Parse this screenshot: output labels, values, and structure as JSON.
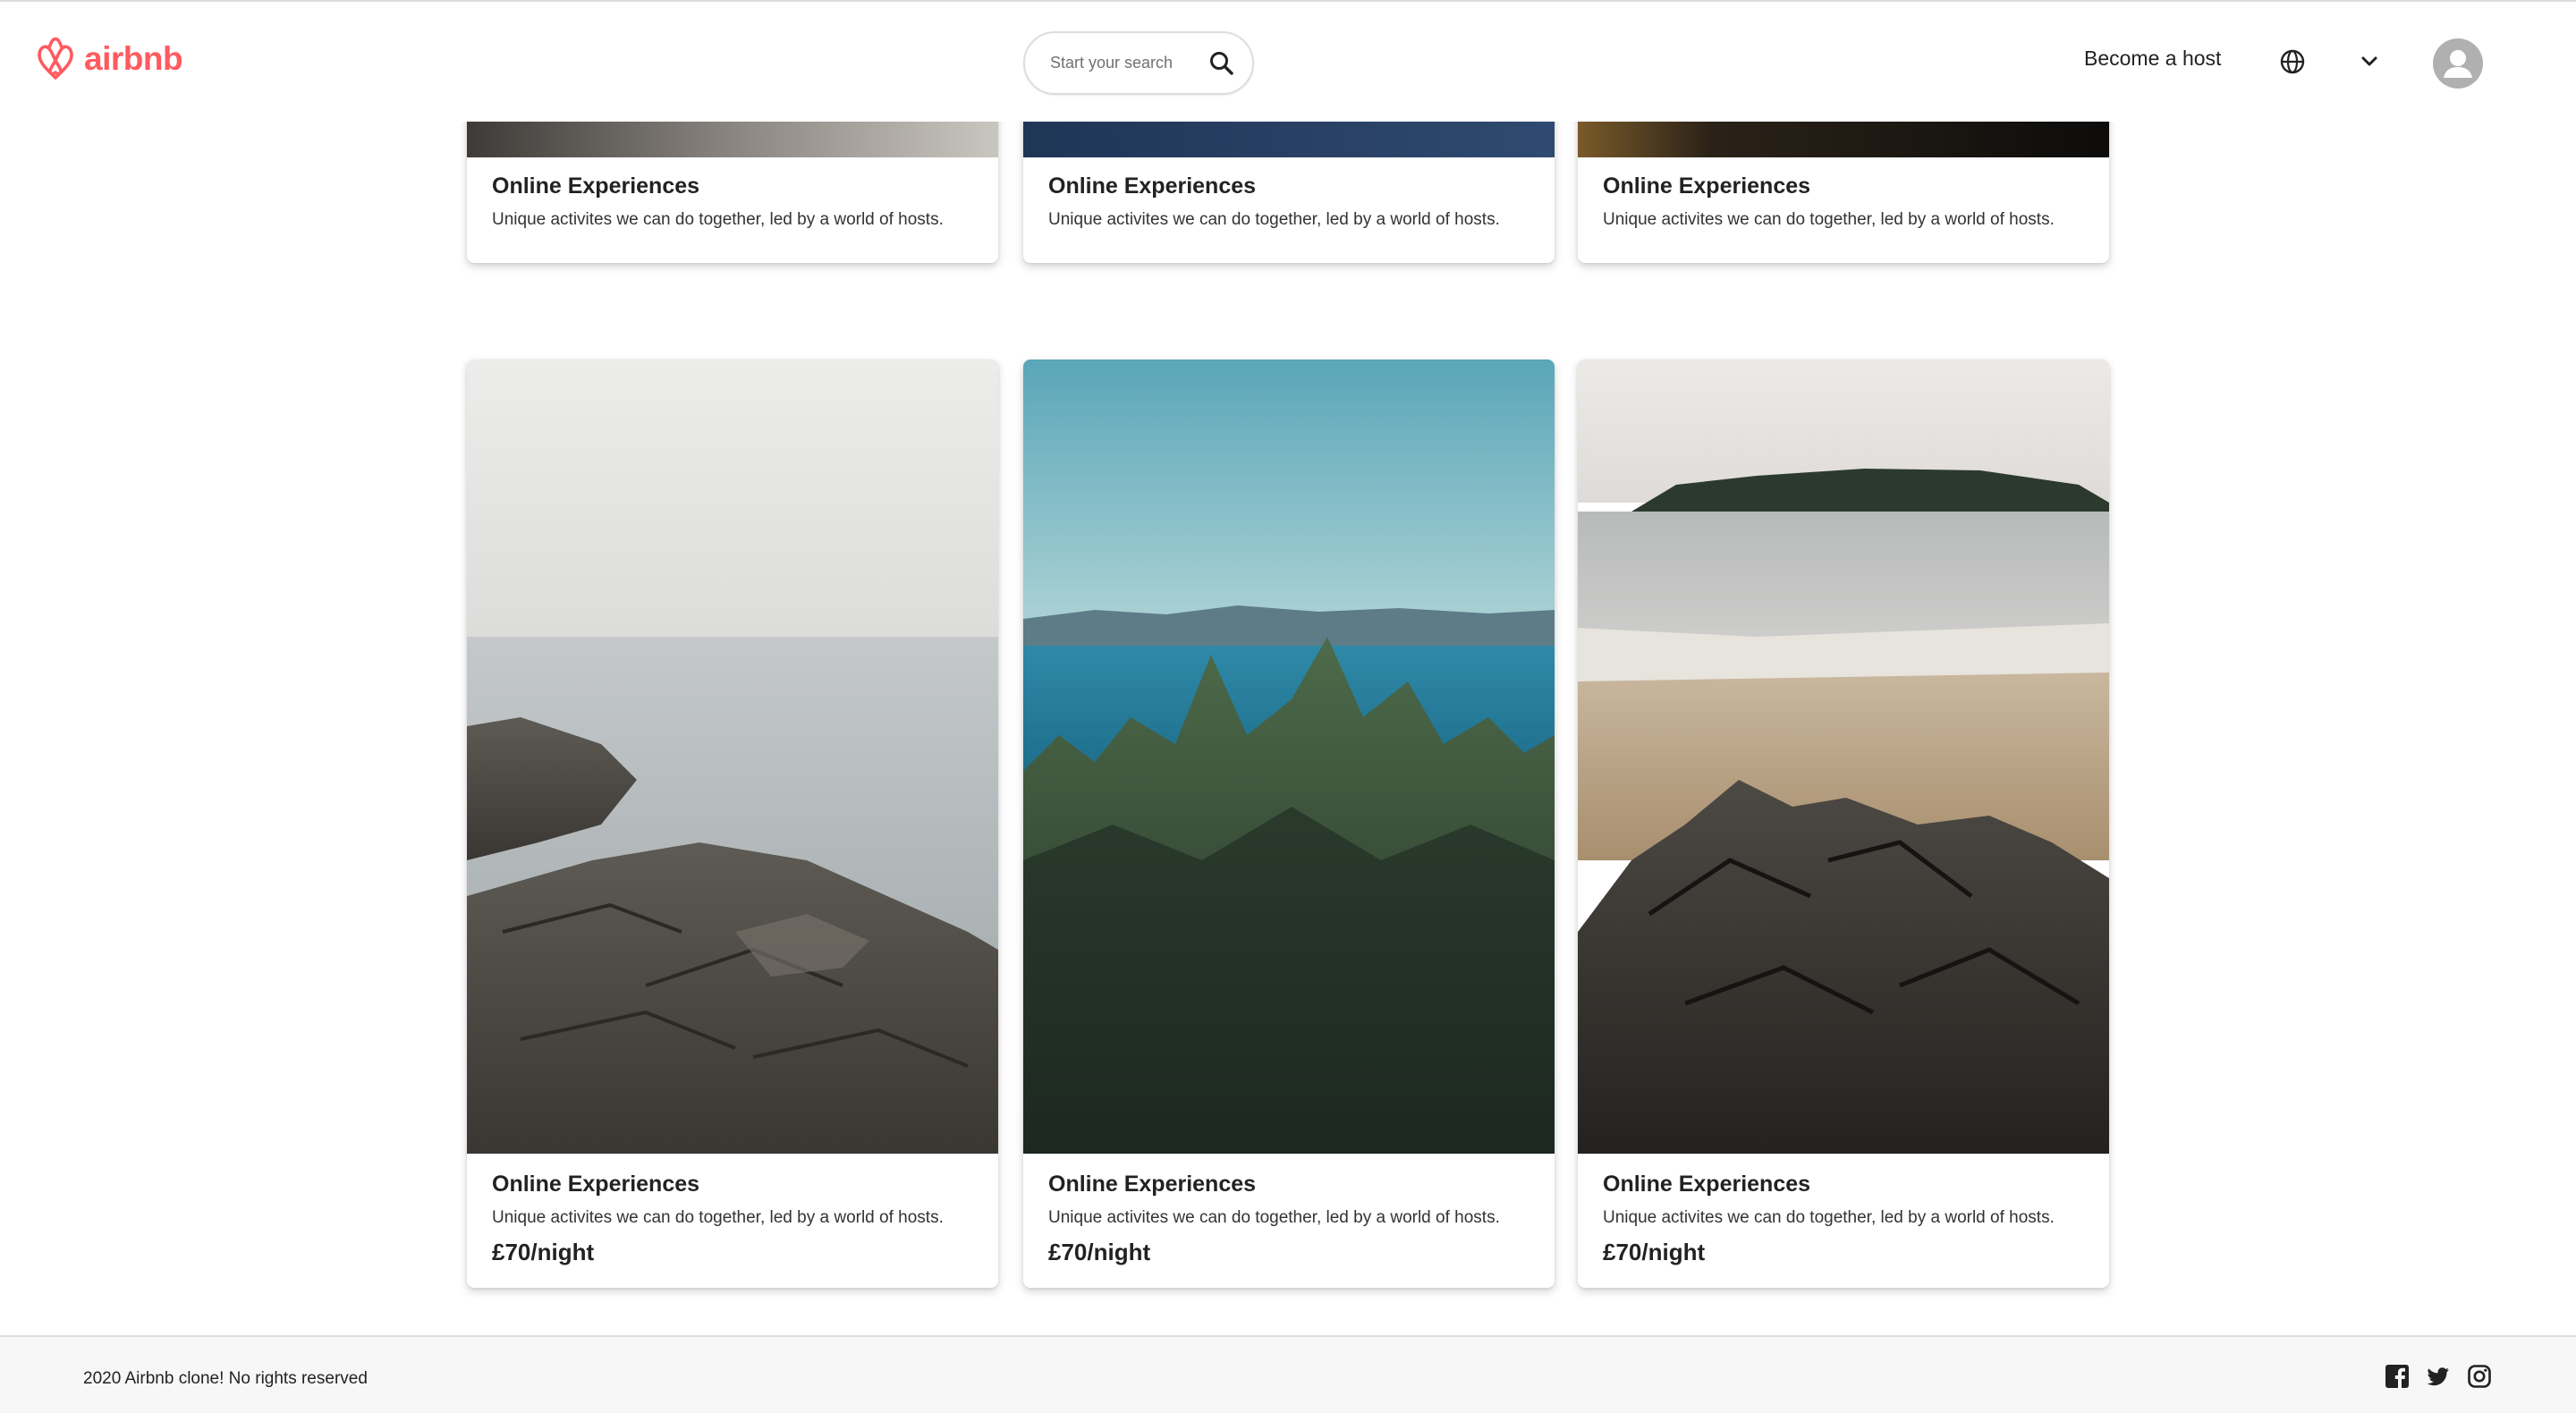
{
  "header": {
    "logo_text": "airbnb",
    "search_placeholder": "Start your search",
    "become_host_label": "Become a host",
    "icons": [
      "airbnb-logo-icon",
      "search-icon",
      "globe-icon",
      "chevron-down-icon",
      "user-avatar-icon"
    ]
  },
  "colors": {
    "brand": "#FF5A5F",
    "text": "#222222",
    "footer_bg": "#F7F7F7",
    "border": "#DDDDDD"
  },
  "top_cards": [
    {
      "title": "Online Experiences",
      "description": "Unique activites we can do together, led by a world of hosts."
    },
    {
      "title": "Online Experiences",
      "description": "Unique activites we can do together, led by a world of hosts."
    },
    {
      "title": "Online Experiences",
      "description": "Unique activites we can do together, led by a world of hosts."
    }
  ],
  "bottom_cards": [
    {
      "title": "Online Experiences",
      "description": "Unique activites we can do together, led by a world of hosts.",
      "price": "£70/night",
      "image": "rocky-shoreline-photo"
    },
    {
      "title": "Online Experiences",
      "description": "Unique activites we can do together, led by a world of hosts.",
      "price": "£70/night",
      "image": "forest-and-lake-photo"
    },
    {
      "title": "Online Experiences",
      "description": "Unique activites we can do together, led by a world of hosts.",
      "price": "£70/night",
      "image": "beach-and-rocks-photo"
    }
  ],
  "footer": {
    "copyright": "2020 Airbnb clone! No rights reserved",
    "social_icons": [
      "facebook-icon",
      "twitter-icon",
      "instagram-icon"
    ]
  }
}
